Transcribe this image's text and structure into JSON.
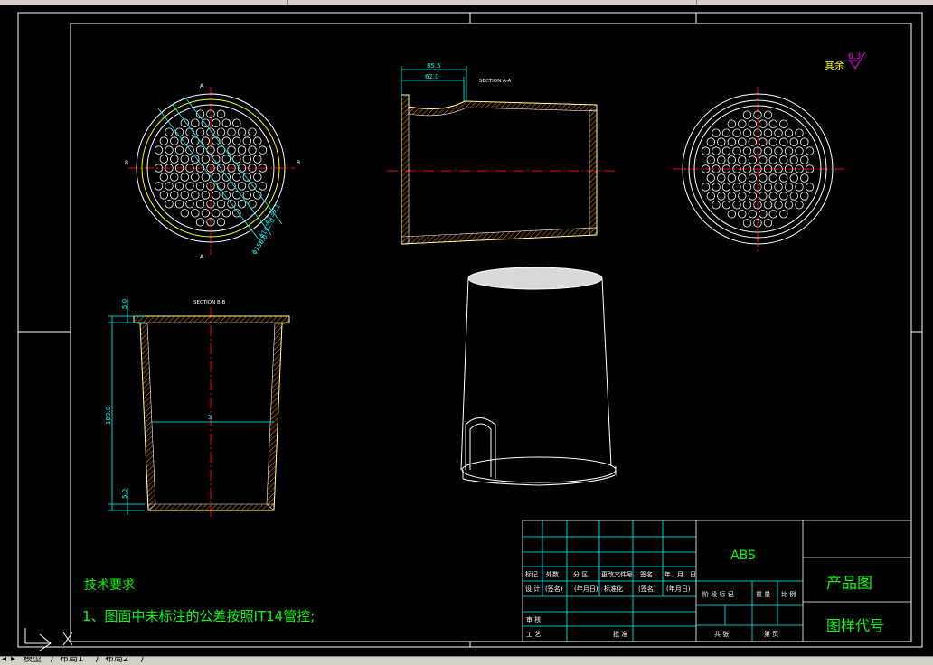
{
  "drawing": {
    "section_aa_label": "SECTION A-A",
    "section_bb_label": "SECTION B-B",
    "dim_top_outer": "85.5",
    "dim_top_inner": "62.0",
    "dim_height": "189.0",
    "dim_lip_top": "5.0",
    "dim_lip_bottom": "5.0",
    "dim_dia_1": "ϕ139.1",
    "dim_dia_2": "ϕ142.0",
    "dim_dia_3": "ϕ150.0",
    "dim_center": "3",
    "marker_a": "A",
    "marker_b": "B",
    "roughness_label": "其余",
    "roughness_value": "6.3",
    "tech_title": "技术要求",
    "tech_line1": "1、图面中未标注的公差按照IT14管控;"
  },
  "title_block": {
    "material": "ABS",
    "product_label": "产品图",
    "drawing_code_label": "图样代号",
    "row1": [
      "标记",
      "处数",
      "分 区",
      "更改文件号",
      "签名",
      "年、月、日"
    ],
    "row2": [
      "设 计",
      "(签名)",
      "(年月日)",
      "标准化",
      "(签名)",
      "(年月日)"
    ],
    "stage_labels": [
      "阶 段 标 记",
      "重 量",
      "比 例"
    ],
    "sheet_labels": [
      "共 张",
      "第 页"
    ],
    "review_label": "审 核",
    "process_label": "工 艺",
    "approve_label": "批 准"
  },
  "tabs": {
    "model_tab": "模型",
    "layout1_tab": "布局1",
    "layout2_tab": "布局2"
  },
  "colors": {
    "frame": "#ffffff",
    "part": "#ffff00",
    "dimension": "#00ffff",
    "centerline": "#ff0000",
    "tech_text": "#00ff00",
    "hatch": "#ff8800",
    "roughness": "#ff00ff"
  }
}
